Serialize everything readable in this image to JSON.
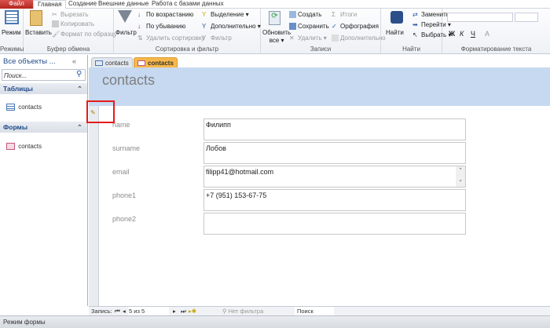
{
  "menu_tabs": [
    "Файл",
    "Главная",
    "Создание",
    "Внешние данные",
    "Работа с базами данных"
  ],
  "ribbon": {
    "views": {
      "label": "Режимы",
      "mode": "Режим"
    },
    "clipboard": {
      "label": "Буфер обмена",
      "paste": "Вставить",
      "cut": "Вырезать",
      "copy": "Копировать",
      "format": "Формат по образцу"
    },
    "sort": {
      "label": "Сортировка и фильтр",
      "filter": "Фильтр",
      "asc": "По возрастанию",
      "desc": "По убыванию",
      "remove": "Удалить сортировку",
      "selection": "Выделение",
      "advanced": "Дополнительно",
      "toggle": "Фильтр"
    },
    "records": {
      "label": "Записи",
      "refresh": "Обновить",
      "refresh2": "все",
      "new": "Создать",
      "save": "Сохранить",
      "delete": "Удалить",
      "totals": "Итоги",
      "spelling": "Орфография",
      "more": "Дополнительно"
    },
    "find": {
      "label": "Найти",
      "find": "Найти",
      "replace": "Заменить",
      "goto": "Перейти",
      "select": "Выбрать"
    },
    "format": {
      "label": "Форматирование текста",
      "bold": "Ж",
      "italic": "К",
      "underline": "Ч",
      "fontcolor": "A"
    }
  },
  "nav": {
    "title": "Все объекты ...",
    "search_placeholder": "Поиск...",
    "tables_header": "Таблицы",
    "table_item": "contacts",
    "forms_header": "Формы",
    "form_item": "contacts"
  },
  "doc_tabs": [
    {
      "label": "contacts"
    },
    {
      "label": "contacts"
    }
  ],
  "form": {
    "title": "contacts",
    "fields": [
      {
        "label": "name",
        "value": "Филипп"
      },
      {
        "label": "surname",
        "value": "Лобов"
      },
      {
        "label": "email",
        "value": "filipp41@hotmail.com"
      },
      {
        "label": "phone1",
        "value": "+7 (951) 153-67-75"
      },
      {
        "label": "phone2",
        "value": ""
      }
    ]
  },
  "navbar": {
    "record_label": "Запись:",
    "position": "5 из 5",
    "filter": "Нет фильтра",
    "search": "Поиск"
  },
  "status": "Режим формы",
  "colors": {
    "accent": "#c6d9f0",
    "file_tab": "#c0392b",
    "active_tab": "#f7b84b"
  }
}
